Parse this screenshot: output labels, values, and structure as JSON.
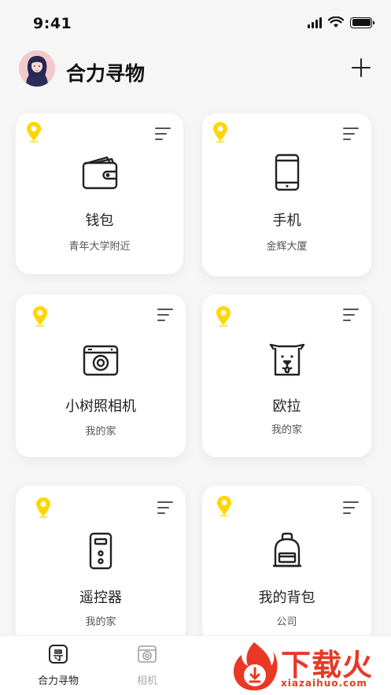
{
  "status_bar": {
    "time": "9:41"
  },
  "header": {
    "title": "合力寻物"
  },
  "items": [
    {
      "name": "钱包",
      "location": "青年大学附近",
      "icon": "wallet-icon"
    },
    {
      "name": "手机",
      "location": "金辉大厦",
      "icon": "phone-icon"
    },
    {
      "name": "小树照相机",
      "location": "我的家",
      "icon": "camera-icon"
    },
    {
      "name": "欧拉",
      "location": "我的家",
      "icon": "dog-icon"
    },
    {
      "name": "遥控器",
      "location": "我的家",
      "icon": "remote-icon"
    },
    {
      "name": "我的背包",
      "location": "公司",
      "icon": "backpack-icon"
    }
  ],
  "tabs": [
    {
      "label": "合力寻物",
      "active": true
    },
    {
      "label": "相机",
      "active": false
    }
  ],
  "watermark": {
    "text": "下载火",
    "url": "xiazaihuo.com"
  },
  "colors": {
    "accent": "#FFD600",
    "background": "#F6F6F6",
    "watermark": "#E93826"
  }
}
